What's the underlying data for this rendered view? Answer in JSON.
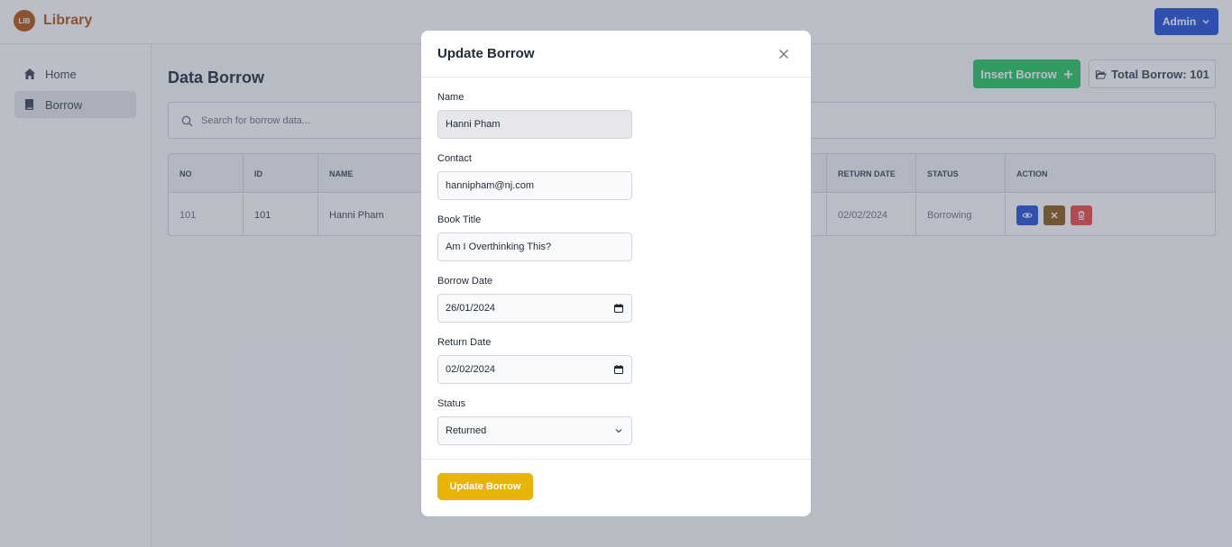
{
  "app": {
    "logo_badge": "LIB",
    "title": "Library",
    "user_menu_label": "Admin"
  },
  "sidebar": {
    "items": [
      {
        "label": "Home"
      },
      {
        "label": "Borrow"
      }
    ]
  },
  "main": {
    "title": "Data Borrow",
    "insert_label": "Insert Borrow",
    "total_label": "Total Borrow: 101",
    "search_placeholder": "Search for borrow data..."
  },
  "table": {
    "headers": [
      "NO",
      "ID",
      "NAME",
      "RETURN DATE",
      "STATUS",
      "ACTION"
    ],
    "row": {
      "no": "101",
      "id": "101",
      "name": "Hanni Pham",
      "return_date": "02/02/2024",
      "status": "Borrowing"
    }
  },
  "modal": {
    "title": "Update Borrow",
    "fields": {
      "name": {
        "label": "Name",
        "value": "Hanni Pham"
      },
      "contact": {
        "label": "Contact",
        "value": "hannipham@nj.com"
      },
      "book_title": {
        "label": "Book Title",
        "value": "Am I Overthinking This?"
      },
      "borrow_date": {
        "label": "Borrow Date",
        "value": "26/01/2024"
      },
      "return_date": {
        "label": "Return Date",
        "value": "02/02/2024"
      },
      "status": {
        "label": "Status",
        "value": "Returned"
      }
    },
    "submit_label": "Update Borrow"
  },
  "colors": {
    "brand": "#b45309",
    "primary": "#1d4ed8",
    "success": "#22c55e",
    "warning": "#eab308",
    "danger": "#ef4444",
    "view": "#1d4ed8",
    "edit": "#8b5a14"
  }
}
